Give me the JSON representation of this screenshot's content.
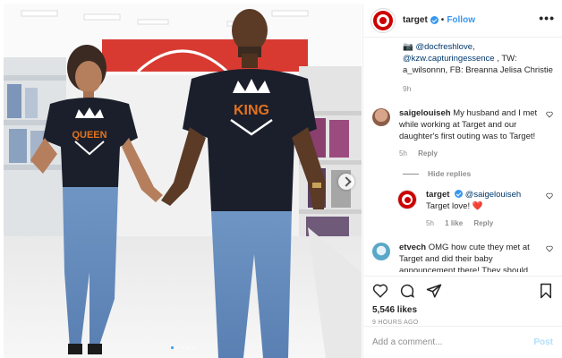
{
  "post": {
    "account": "target",
    "follow_label": "Follow",
    "separator": "•",
    "more_label": "•••",
    "image": {
      "shirt_left_text": "QUEEN",
      "shirt_right_text": "KING",
      "carousel_dots": 5,
      "active_dot": 0
    },
    "caption_tail": {
      "camera_glyph": "📷",
      "mention1": "@docfreshlove",
      "sep": ", ",
      "mention2": "@kzw.capturingessence",
      "rest": " , TW: a_wilsonnn, FB: Breanna Jelisa Christie",
      "time": "9h"
    },
    "comments": [
      {
        "user": "saigelouiseh",
        "text": "My husband and I met while working at Target and our daughter's first outing was to Target!",
        "time": "5h",
        "reply_label": "Reply"
      }
    ],
    "hide_replies_label": "Hide replies",
    "reply": {
      "user": "target",
      "mention": "@saigelouiseh",
      "text": "Target love! ❤️",
      "time": "5h",
      "likes": "1 like",
      "reply_label": "Reply"
    },
    "comment3": {
      "user": "etvech",
      "text": "OMG how cute they met at Target and did their baby announcement there! They should"
    },
    "likes": "5,546 likes",
    "posted": "9 HOURS AGO",
    "add_comment_placeholder": "Add a comment...",
    "post_label": "Post"
  },
  "colors": {
    "accent_blue": "#3897f0",
    "target_red": "#cc0000",
    "muted": "#8e8e8e"
  },
  "icons": [
    "bullseye-logo-icon",
    "verified-badge-icon",
    "more-options-icon",
    "heart-icon",
    "comment-icon",
    "share-icon",
    "save-bookmark-icon",
    "next-arrow-icon"
  ]
}
